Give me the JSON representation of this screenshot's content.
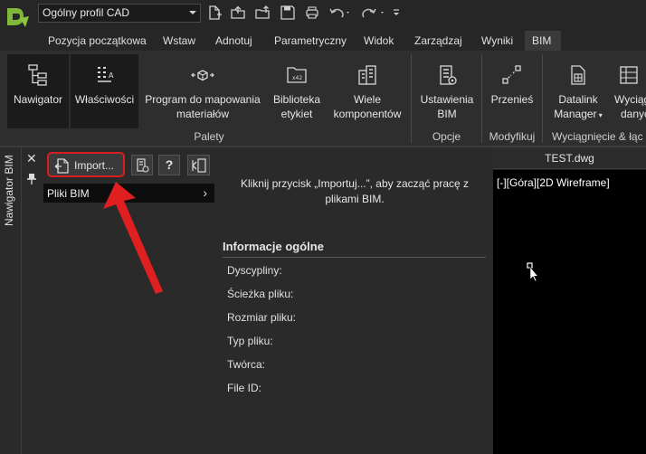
{
  "qat": {
    "profile": "Ogólny profil CAD",
    "icons": [
      "new-file-icon",
      "open-icon",
      "open-upload-icon",
      "save-icon",
      "print-icon",
      "undo-icon",
      "redo-icon",
      "overflow-icon"
    ]
  },
  "tabs": [
    "Pozycja początkowa",
    "Wstaw",
    "Adnotuj",
    "Parametryczny",
    "Widok",
    "Zarządzaj",
    "Wyniki",
    "BIM"
  ],
  "ribbon": {
    "buttons": {
      "navigator": "Nawigator",
      "properties": "Właściwości",
      "mapping_1": "Program do mapowania",
      "mapping_2": "materiałów",
      "library_1": "Biblioteka",
      "library_2": "etykiet",
      "multi_1": "Wiele",
      "multi_2": "komponentów",
      "settings_1": "Ustawienia",
      "settings_2": "BIM",
      "move": "Przenieś",
      "datalink_1": "Datalink",
      "datalink_2": "Manager",
      "extract_1": "Wyciąg",
      "extract_2": "danyc"
    },
    "groups": {
      "palettes": "Palety",
      "options": "Opcje",
      "modify": "Modyfikuj",
      "extract": "Wyciągnięcie & łąc"
    }
  },
  "side": {
    "label": "Nawigator BIM"
  },
  "navigator": {
    "import_label": "Import...",
    "help_label": "?",
    "bim_files": "Pliki BIM"
  },
  "info": {
    "hint": "Kliknij przycisk „Importuj...”, aby zacząć pracę z plikami BIM.",
    "title": "Informacje ogólne",
    "fields": [
      "Dyscypliny:",
      "Ścieżka pliku:",
      "Rozmiar pliku:",
      "Typ pliku:",
      "Twórca:",
      "File ID:"
    ]
  },
  "drawing": {
    "tab": "TEST.dwg",
    "view_label": "[-][Góra][2D Wireframe]"
  },
  "colors": {
    "annotation": "#d81e1e",
    "background": "#1f1f1f"
  }
}
